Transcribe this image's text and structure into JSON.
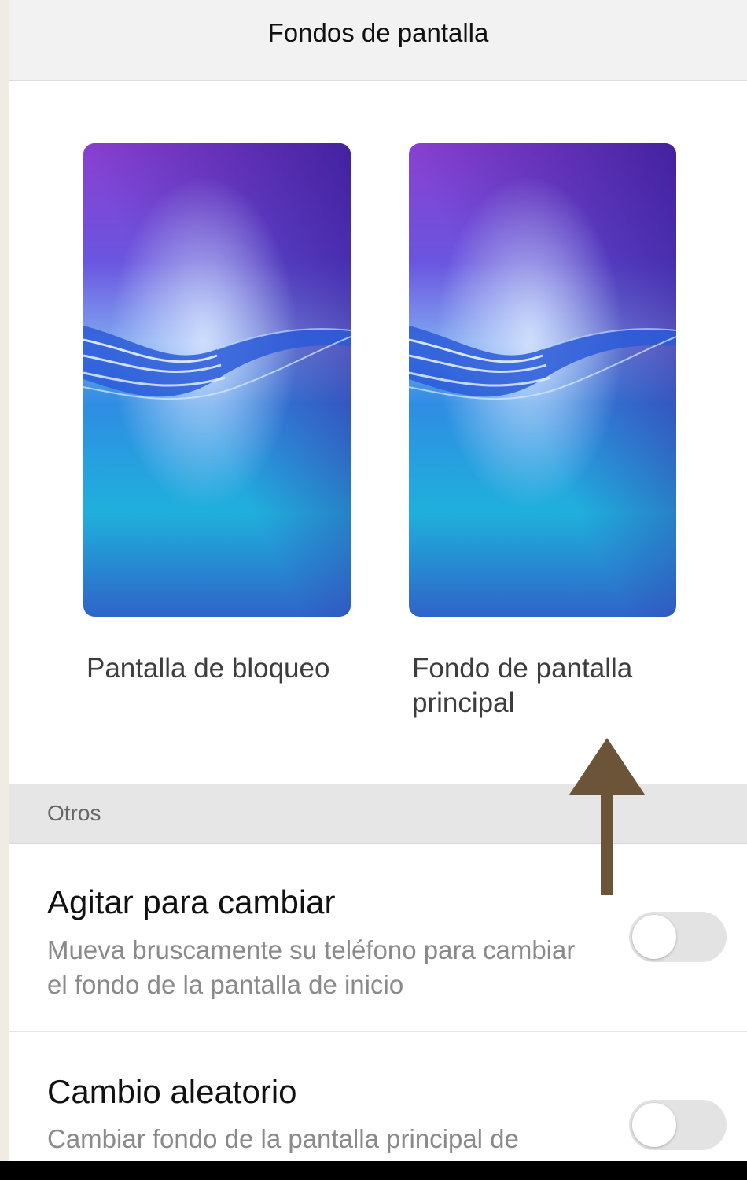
{
  "header": {
    "title": "Fondos de pantalla"
  },
  "wallpapers": [
    {
      "label": "Pantalla de bloqueo"
    },
    {
      "label": "Fondo de pantalla principal"
    }
  ],
  "section": {
    "label": "Otros"
  },
  "settings": [
    {
      "title": "Agitar para cambiar",
      "description": "Mueva bruscamente su teléfono para cambiar el fondo de la pantalla de inicio",
      "enabled": false
    },
    {
      "title": "Cambio aleatorio",
      "description": "Cambiar fondo de la pantalla principal de",
      "enabled": false
    }
  ],
  "colors": {
    "arrow": "#6b5438",
    "toggle_off": "#e3e3e3",
    "wallpaper_top": "#8a3fd1",
    "wallpaper_bottom": "#1a9ad8"
  },
  "icons": {
    "annotation": "up-arrow-icon"
  }
}
